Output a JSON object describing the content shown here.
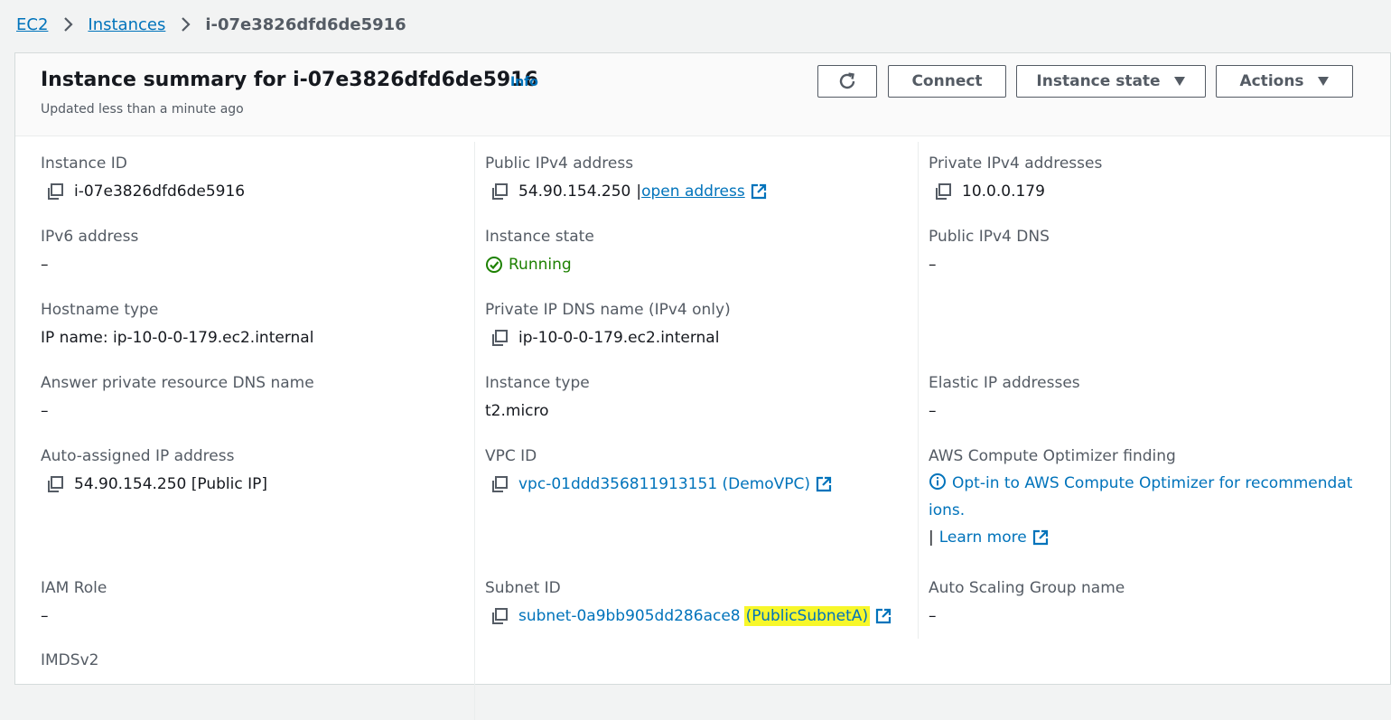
{
  "breadcrumb": {
    "items": [
      "EC2",
      "Instances"
    ],
    "current": "i-07e3826dfd6de5916"
  },
  "header": {
    "title": "Instance summary for i-07e3826dfd6de5916",
    "info": "Info",
    "subtitle": "Updated less than a minute ago",
    "buttons": {
      "connect": "Connect",
      "instance_state": "Instance state",
      "actions": "Actions"
    }
  },
  "fields": {
    "instance_id": {
      "label": "Instance ID",
      "value": "i-07e3826dfd6de5916"
    },
    "public_ipv4": {
      "label": "Public IPv4 address",
      "value": "54.90.154.250",
      "sep": "|",
      "link": "open address"
    },
    "private_ipv4": {
      "label": "Private IPv4 addresses",
      "value": "10.0.0.179"
    },
    "ipv6": {
      "label": "IPv6 address",
      "value": "–"
    },
    "instance_state": {
      "label": "Instance state",
      "value": "Running"
    },
    "public_dns": {
      "label": "Public IPv4 DNS",
      "value": "–"
    },
    "hostname_type": {
      "label": "Hostname type",
      "value": "IP name: ip-10-0-0-179.ec2.internal"
    },
    "private_dns": {
      "label": "Private IP DNS name (IPv4 only)",
      "value": "ip-10-0-0-179.ec2.internal"
    },
    "answer_dns": {
      "label": "Answer private resource DNS name",
      "value": "–"
    },
    "instance_type": {
      "label": "Instance type",
      "value": "t2.micro"
    },
    "elastic_ip": {
      "label": "Elastic IP addresses",
      "value": "–"
    },
    "auto_ip": {
      "label": "Auto-assigned IP address",
      "value": "54.90.154.250 [Public IP]"
    },
    "vpc_id": {
      "label": "VPC ID",
      "value": "vpc-01ddd356811913151 (DemoVPC)"
    },
    "optimizer": {
      "label": "AWS Compute Optimizer finding",
      "link": "Opt-in to AWS Compute Optimizer for recommendations.",
      "sep": "|",
      "learn": "Learn more"
    },
    "iam_role": {
      "label": "IAM Role",
      "value": "–"
    },
    "subnet_id": {
      "label": "Subnet ID",
      "value": "subnet-0a9bb905dd286ace8",
      "highlight": "(PublicSubnetA)"
    },
    "asg_name": {
      "label": "Auto Scaling Group name",
      "value": "–"
    },
    "imdsv2": {
      "label": "IMDSv2"
    }
  },
  "colors": {
    "link": "#0073bb",
    "running": "#1d8102",
    "highlight": "#f7f72a"
  }
}
